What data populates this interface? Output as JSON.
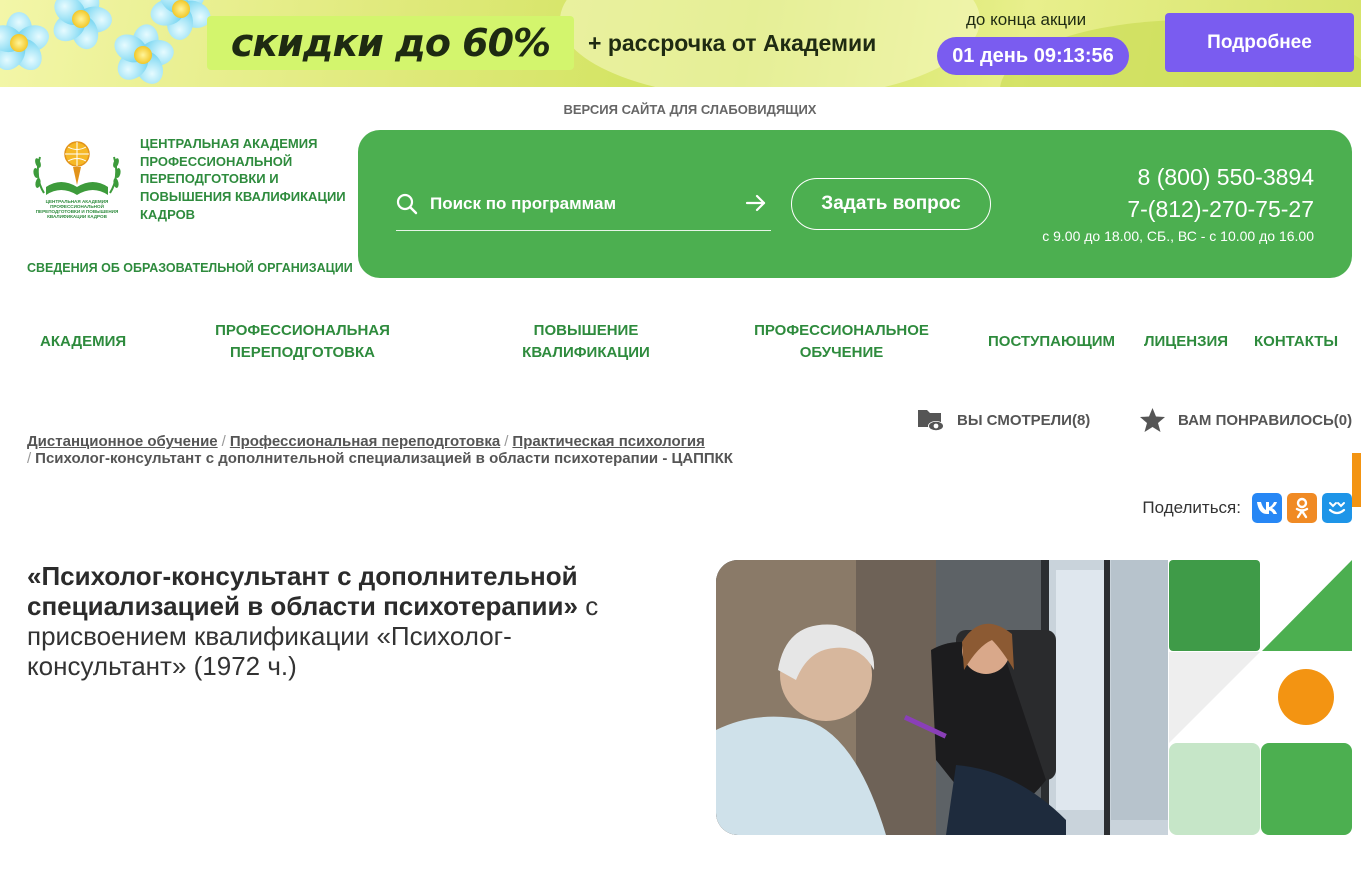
{
  "promo": {
    "headline": "скидки до 60%",
    "subline": "+ рассрочка от Академии",
    "until_label": "до конца акции",
    "timer": "01 день 09:13:56",
    "button": "Подробнее"
  },
  "low_vision_link": "ВЕРСИЯ САЙТА ДЛЯ СЛАБОВИДЯЩИХ",
  "logo": {
    "name": "ЦЕНТРАЛЬНАЯ АКАДЕМИЯ ПРОФЕССИОНАЛЬНОЙ ПЕРЕПОДГОТОВКИ И ПОВЫШЕНИЯ КВАЛИФИКАЦИИ КАДРОВ",
    "emblem_caption": "ЦЕНТРАЛЬНАЯ АКАДЕМИЯ ПРОФЕССИОНАЛЬНОЙ ПЕРЕПОДГОТОВКИ И ПОВЫШЕНИЯ КВАЛИФИКАЦИИ КАДРОВ"
  },
  "org_info_link": "СВЕДЕНИЯ ОБ ОБРАЗОВАТЕЛЬНОЙ ОРГАНИЗАЦИИ",
  "header": {
    "search_placeholder": "Поиск по программам",
    "ask_button": "Задать вопрос",
    "phone_1": "8 (800) 550-3894",
    "phone_2": "7-(812)-270-75-27",
    "hours": "с 9.00 до 18.00, СБ., ВС - с 10.00 до 16.00"
  },
  "nav": {
    "academy": "АКАДЕМИЯ",
    "retraining_1": "ПРОФЕССИОНАЛЬНАЯ",
    "retraining_2": "ПЕРЕПОДГОТОВКА",
    "qualification_1": "ПОВЫШЕНИЕ",
    "qualification_2": "КВАЛИФИКАЦИИ",
    "training_1": "ПРОФЕССИОНАЛЬНОЕ",
    "training_2": "ОБУЧЕНИЕ",
    "applicants": "ПОСТУПАЮЩИМ",
    "license": "ЛИЦЕНЗИЯ",
    "contacts": "КОНТАКТЫ"
  },
  "user_meta": {
    "viewed": "ВЫ СМОТРЕЛИ(8)",
    "liked": "ВАМ ПОНРАВИЛОСЬ(0)"
  },
  "breadcrumbs": {
    "item_1": "Дистанционное обучение",
    "item_2": "Профессиональная переподготовка",
    "item_3": "Практическая психология",
    "current": "Психолог-консультант с дополнительной специализацией в области психотерапии - ЦАППКК",
    "separator": "/"
  },
  "share": {
    "label": "Поделиться:",
    "vk": "VK",
    "ok": "OK",
    "mail": "Мой Мир"
  },
  "course": {
    "title_bold": "«Психолог-консультант с дополнительной специализацией в области психотерапии»",
    "title_rest": " с присвоением квалификации «Психолог-консультант» (1972 ч.)"
  },
  "colors": {
    "brand_green": "#4caf50",
    "text_green": "#2e8b3d",
    "promo_purple": "#7a5cf0",
    "accent_orange": "#f39412"
  }
}
